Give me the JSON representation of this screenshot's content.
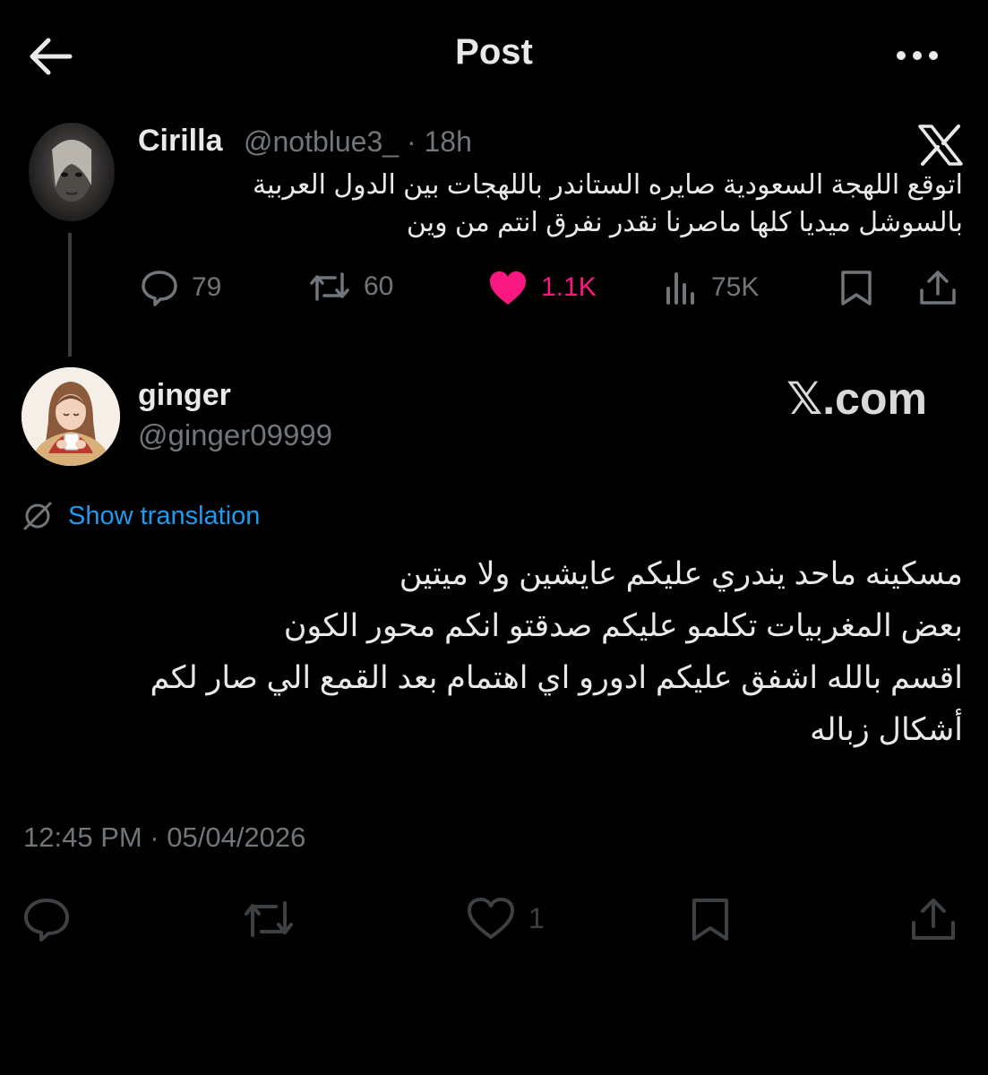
{
  "header": {
    "title": "Post"
  },
  "quoted_post": {
    "author_name": "Cirilla",
    "author_handle": "@notblue3_",
    "time": "18h",
    "lines": [
      "اتوقع اللهجة السعودية صايره الستاندر باللهجات بين الدول العربية",
      "بالسوشل ميديا كلها ماصرنا نقدر نفرق انتم من وين"
    ],
    "replies": "79",
    "reposts": "60",
    "likes": "1.1K",
    "views": "75K"
  },
  "post": {
    "author_name": "ginger",
    "author_handle": "@ginger09999",
    "watermark": "𝕏.com",
    "translate_label": "Show translation",
    "lines": [
      "مسكينه ماحد يندري عليكم عايشين ولا ميتين",
      "بعض المغربيات تكلمو عليكم صدقتو انكم محور الكون",
      "اقسم بالله اشفق عليكم ادورو اي اهتمام بعد القمع الي صار لكم",
      "أشكال زباله"
    ],
    "timestamp": "12:45 PM · 05/04/2026",
    "likes": "1"
  },
  "colors": {
    "background": "#000000",
    "text": "#e7e9ea",
    "muted": "#71767b",
    "like": "#f91880",
    "link": "#1d9bf0"
  },
  "icons": [
    "back-arrow-icon",
    "more-icon",
    "x-logo-icon",
    "reply-icon",
    "repost-icon",
    "heart-icon",
    "views-icon",
    "bookmark-icon",
    "share-icon",
    "translate-icon"
  ]
}
